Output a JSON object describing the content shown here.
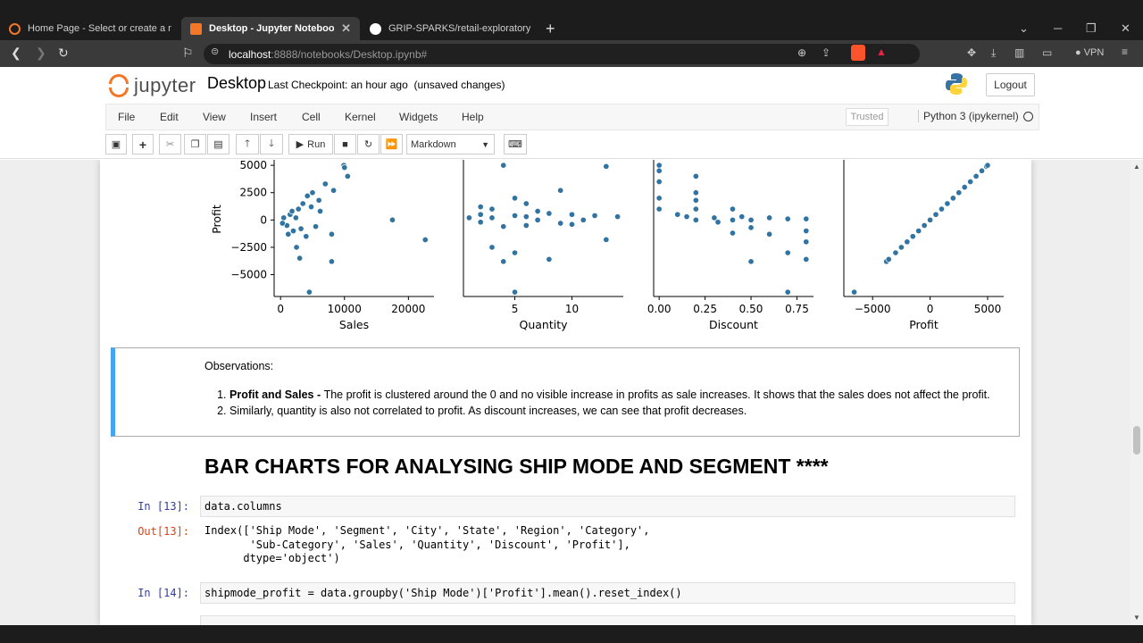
{
  "browser": {
    "tabs": [
      {
        "label": "Home Page - Select or create a notebo",
        "active": false
      },
      {
        "label": "Desktop - Jupyter Notebook",
        "active": true
      },
      {
        "label": "GRIP-SPARKS/retail-exploratory-data-a",
        "active": false
      }
    ],
    "url_host": "localhost",
    "url_path": ":8888/notebooks/Desktop.ipynb#",
    "vpn_label": "VPN"
  },
  "jupyter": {
    "logo_text": "jupyter",
    "notebook_name": "Desktop",
    "checkpoint": "Last Checkpoint: an hour ago",
    "unsaved": "(unsaved changes)",
    "logout": "Logout",
    "menu": [
      "File",
      "Edit",
      "View",
      "Insert",
      "Cell",
      "Kernel",
      "Widgets",
      "Help"
    ],
    "trusted": "Trusted",
    "kernel": "Python 3 (ipykernel)",
    "run_label": "Run",
    "cell_type": "Markdown"
  },
  "chart_data": [
    {
      "type": "scatter",
      "xlabel": "Sales",
      "ylabel": "Profit",
      "xticks": [
        "0",
        "10000",
        "20000"
      ],
      "yticks": [
        "5000",
        "2500",
        "0",
        "−2500",
        "−5000"
      ],
      "xlim": [
        -1000,
        24000
      ],
      "ylim": [
        -7000,
        5500
      ],
      "points": [
        [
          22638,
          -1811
        ],
        [
          4500,
          -6600
        ],
        [
          8000,
          -3800
        ],
        [
          17500,
          8
        ],
        [
          9900,
          5000
        ],
        [
          10500,
          4000
        ],
        [
          10000,
          4800
        ],
        [
          8300,
          2700
        ],
        [
          7000,
          3300
        ],
        [
          8000,
          -1300
        ],
        [
          6000,
          1800
        ],
        [
          5500,
          -600
        ],
        [
          4000,
          -1500
        ],
        [
          3000,
          -3500
        ],
        [
          2500,
          -2500
        ],
        [
          2000,
          -1000
        ],
        [
          1500,
          500
        ],
        [
          1000,
          -500
        ],
        [
          500,
          200
        ],
        [
          300,
          -300
        ],
        [
          3500,
          1500
        ],
        [
          4200,
          2200
        ],
        [
          2800,
          1000
        ],
        [
          1800,
          800
        ],
        [
          3200,
          -800
        ],
        [
          5000,
          2500
        ],
        [
          6200,
          800
        ],
        [
          2400,
          200
        ],
        [
          1200,
          -1300
        ],
        [
          4800,
          1200
        ]
      ]
    },
    {
      "type": "scatter",
      "xlabel": "Quantity",
      "ylabel": "",
      "xticks": [
        "5",
        "10"
      ],
      "xlim": [
        0.5,
        14.5
      ],
      "ylim": [
        -7000,
        5500
      ],
      "points": [
        [
          1,
          200
        ],
        [
          2,
          500
        ],
        [
          2,
          -200
        ],
        [
          3,
          1000
        ],
        [
          3,
          -2500
        ],
        [
          4,
          5000
        ],
        [
          4,
          -3800
        ],
        [
          5,
          -6600
        ],
        [
          5,
          2000
        ],
        [
          5,
          -3000
        ],
        [
          6,
          1500
        ],
        [
          6,
          -500
        ],
        [
          7,
          800
        ],
        [
          7,
          0
        ],
        [
          8,
          -3600
        ],
        [
          9,
          2700
        ],
        [
          9,
          -300
        ],
        [
          10,
          500
        ],
        [
          11,
          0
        ],
        [
          12,
          400
        ],
        [
          13,
          4900
        ],
        [
          13,
          -1800
        ],
        [
          14,
          300
        ],
        [
          3,
          200
        ],
        [
          4,
          -600
        ],
        [
          6,
          300
        ],
        [
          8,
          600
        ],
        [
          2,
          1200
        ],
        [
          5,
          400
        ],
        [
          10,
          -400
        ]
      ]
    },
    {
      "type": "scatter",
      "xlabel": "Discount",
      "ylabel": "",
      "xticks": [
        "0.00",
        "0.25",
        "0.50",
        "0.75"
      ],
      "xlim": [
        -0.03,
        0.84
      ],
      "ylim": [
        -7000,
        5500
      ],
      "points": [
        [
          0.0,
          5000
        ],
        [
          0.0,
          3500
        ],
        [
          0.0,
          2000
        ],
        [
          0.0,
          1000
        ],
        [
          0.1,
          500
        ],
        [
          0.15,
          300
        ],
        [
          0.2,
          4000
        ],
        [
          0.2,
          2500
        ],
        [
          0.2,
          1000
        ],
        [
          0.2,
          0
        ],
        [
          0.3,
          200
        ],
        [
          0.32,
          -200
        ],
        [
          0.4,
          1000
        ],
        [
          0.4,
          -1200
        ],
        [
          0.45,
          300
        ],
        [
          0.5,
          -700
        ],
        [
          0.5,
          -3800
        ],
        [
          0.6,
          200
        ],
        [
          0.6,
          -1300
        ],
        [
          0.7,
          -6600
        ],
        [
          0.7,
          100
        ],
        [
          0.7,
          -3000
        ],
        [
          0.8,
          100
        ],
        [
          0.8,
          -3600
        ],
        [
          0.8,
          -2000
        ],
        [
          0.0,
          4500
        ],
        [
          0.2,
          1800
        ],
        [
          0.4,
          0
        ],
        [
          0.5,
          0
        ],
        [
          0.8,
          -1000
        ]
      ]
    },
    {
      "type": "scatter",
      "xlabel": "Profit",
      "ylabel": "",
      "xticks": [
        "−5000",
        "0",
        "5000"
      ],
      "xlim": [
        -7500,
        6400
      ],
      "ylim": [
        -7000,
        5500
      ],
      "points": [
        [
          -6600,
          -6600
        ],
        [
          -3800,
          -3800
        ],
        [
          -3600,
          -3600
        ],
        [
          -3000,
          -3000
        ],
        [
          -2500,
          -2500
        ],
        [
          -2000,
          -2000
        ],
        [
          -1500,
          -1500
        ],
        [
          -1000,
          -1000
        ],
        [
          -500,
          -500
        ],
        [
          0,
          0
        ],
        [
          500,
          500
        ],
        [
          1000,
          1000
        ],
        [
          1500,
          1500
        ],
        [
          2000,
          2000
        ],
        [
          2500,
          2500
        ],
        [
          3000,
          3000
        ],
        [
          3500,
          3500
        ],
        [
          4000,
          4000
        ],
        [
          4500,
          4500
        ],
        [
          4900,
          4900
        ],
        [
          5000,
          5000
        ]
      ]
    }
  ],
  "markdown": {
    "heading": "Observations:",
    "items": [
      {
        "bold": "Profit and Sales - ",
        "text": "The profit is clustered around the 0 and no visible increase in profits as sale increases. It shows that the sales does not affect the profit."
      },
      {
        "bold": "",
        "text": "Similarly, quantity is also not correlated to profit. As discount increases, we can see that profit decreases."
      }
    ]
  },
  "section_heading": "BAR CHARTS FOR ANALYSING SHIP MODE AND SEGMENT ****",
  "cells": {
    "in13_prompt": "In [13]:",
    "in13_code": "data.columns",
    "out13_prompt": "Out[13]:",
    "out13_text": "Index(['Ship Mode', 'Segment', 'City', 'State', 'Region', 'Category',\n       'Sub-Category', 'Sales', 'Quantity', 'Discount', 'Profit'],\n      dtype='object')",
    "in14_prompt": "In [14]:",
    "in14_code": "shipmode_profit = data.groupby('Ship Mode')['Profit'].mean().reset_index()"
  },
  "colors": {
    "point": "#3274a1",
    "accent": "#f37726",
    "md_border": "#42a5f5"
  }
}
